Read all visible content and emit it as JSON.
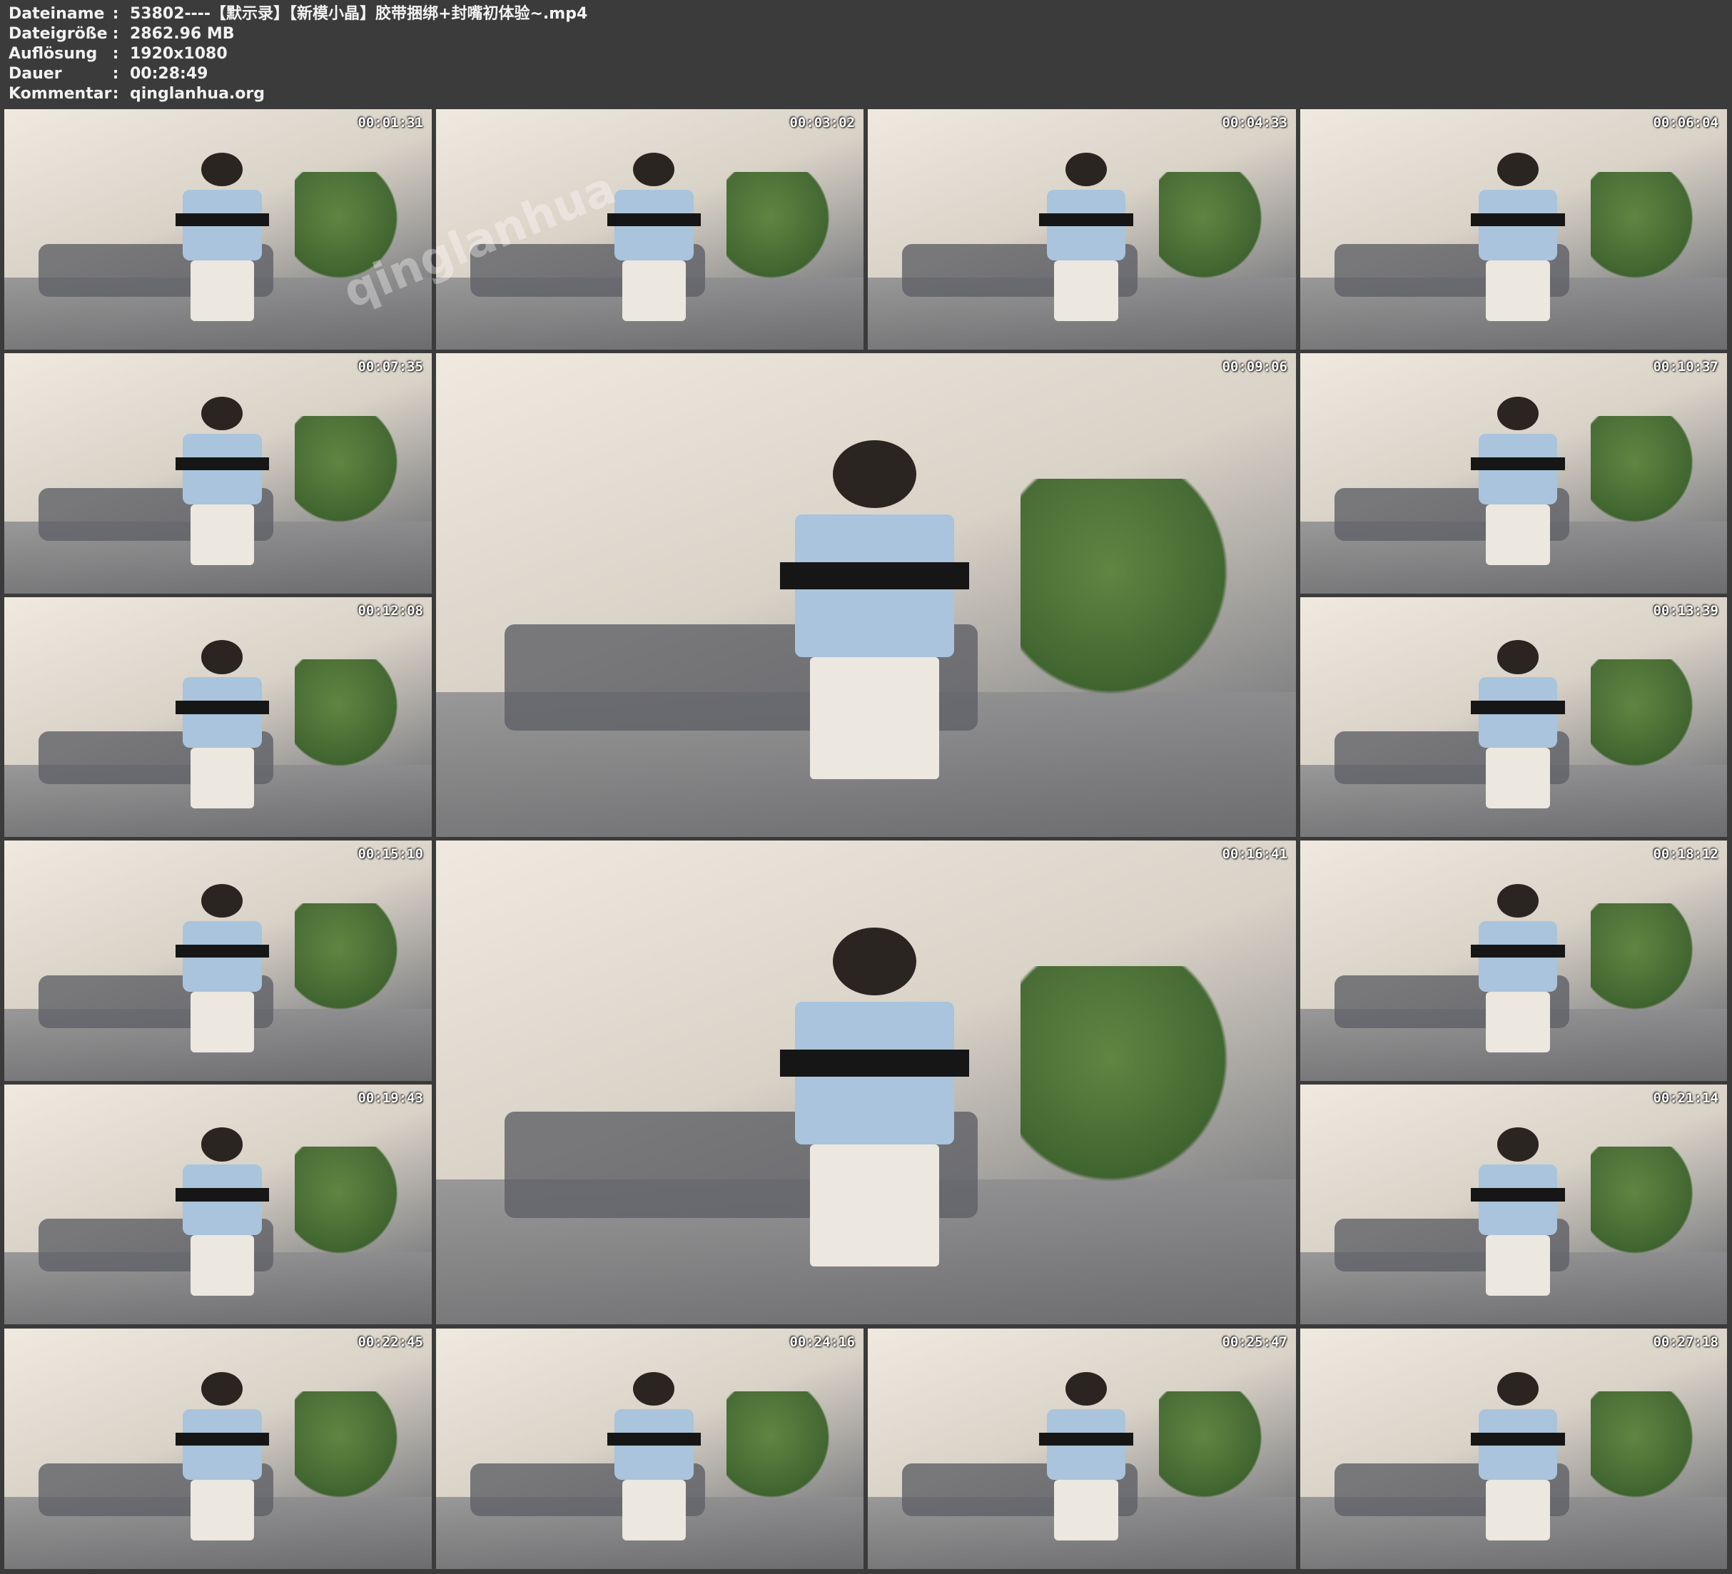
{
  "header": {
    "rows": [
      {
        "key": "Dateiname",
        "sep": ":",
        "value": "53802----【默示录】【新模小晶】胶带捆绑+封嘴初体验~.mp4"
      },
      {
        "key": "Dateigröße",
        "sep": ":",
        "value": "2862.96 MB"
      },
      {
        "key": "Auflösung",
        "sep": ":",
        "value": "1920x1080"
      },
      {
        "key": "Dauer",
        "sep": ":",
        "value": "00:28:49"
      },
      {
        "key": "Kommentar",
        "sep": ":",
        "value": "qinglanhua.org"
      }
    ]
  },
  "thumbnails": [
    {
      "time": "00:01:31"
    },
    {
      "time": "00:03:02"
    },
    {
      "time": "00:04:33"
    },
    {
      "time": "00:06:04"
    },
    {
      "time": "00:07:35"
    },
    {
      "time": "00:09:06"
    },
    {
      "time": "00:10:37"
    },
    {
      "time": "00:12:08"
    },
    {
      "time": "00:13:39"
    },
    {
      "time": "00:15:10"
    },
    {
      "time": "00:16:41"
    },
    {
      "time": "00:18:12"
    },
    {
      "time": "00:19:43"
    },
    {
      "time": "00:21:14"
    },
    {
      "time": "00:22:45"
    },
    {
      "time": "00:24:16"
    },
    {
      "time": "00:25:47"
    },
    {
      "time": "00:27:18"
    }
  ],
  "watermark": "qinglanhua"
}
